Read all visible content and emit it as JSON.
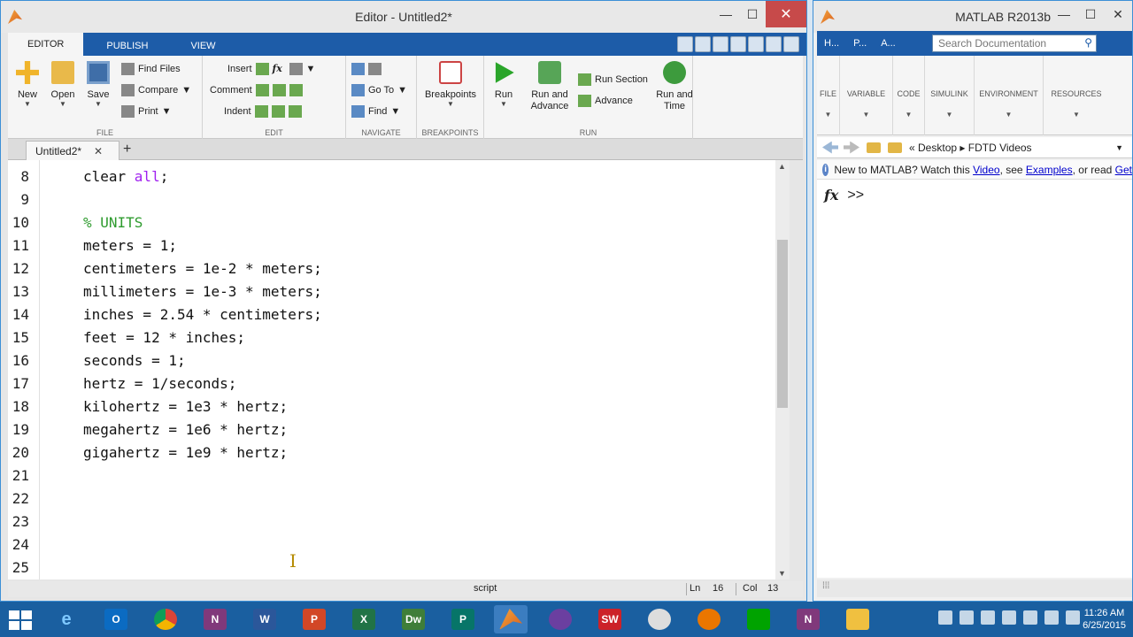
{
  "editor": {
    "title": "Editor - Untitled2*",
    "ribbon_tabs": [
      "EDITOR",
      "PUBLISH",
      "VIEW"
    ],
    "file_group": {
      "label": "FILE",
      "new": "New",
      "open": "Open",
      "save": "Save",
      "find_files": "Find Files",
      "compare": "Compare",
      "print": "Print"
    },
    "edit_group": {
      "label": "EDIT",
      "insert": "Insert",
      "comment": "Comment",
      "indent": "Indent"
    },
    "navigate_group": {
      "label": "NAVIGATE",
      "go_to": "Go To",
      "find": "Find"
    },
    "breakpoints_group": {
      "label": "BREAKPOINTS",
      "breakpoints": "Breakpoints"
    },
    "run_group": {
      "label": "RUN",
      "run": "Run",
      "run_and_advance": "Run and Advance",
      "run_section": "Run Section",
      "advance": "Advance",
      "run_and_time": "Run and Time"
    },
    "doc_tab": "Untitled2*",
    "lines": [
      {
        "n": "8",
        "code": "clear all;"
      },
      {
        "n": "9",
        "code": ""
      },
      {
        "n": "10",
        "code": "% UNITS"
      },
      {
        "n": "11",
        "code": "meters = 1;"
      },
      {
        "n": "12",
        "code": "centimeters = 1e-2 * meters;"
      },
      {
        "n": "13",
        "code": "millimeters = 1e-3 * meters;"
      },
      {
        "n": "14",
        "code": "inches = 2.54 * centimeters;"
      },
      {
        "n": "15",
        "code": "feet = 12 * inches;"
      },
      {
        "n": "16",
        "code": "seconds = 1;"
      },
      {
        "n": "17",
        "code": "hertz = 1/seconds;"
      },
      {
        "n": "18",
        "code": "kilohertz = 1e3 * hertz;"
      },
      {
        "n": "19",
        "code": "megahertz = 1e6 * hertz;"
      },
      {
        "n": "20",
        "code": "gigahertz = 1e9 * hertz;"
      },
      {
        "n": "21",
        "code": ""
      },
      {
        "n": "22",
        "code": ""
      },
      {
        "n": "23",
        "code": ""
      },
      {
        "n": "24",
        "code": ""
      },
      {
        "n": "25",
        "code": ""
      }
    ],
    "status": {
      "mode": "script",
      "ln_label": "Ln",
      "ln": "16",
      "col_label": "Col",
      "col": "13"
    }
  },
  "matlab": {
    "title": "MATLAB R2013b",
    "tabs": [
      "H...",
      "P...",
      "A..."
    ],
    "search_placeholder": "Search Documentation",
    "ribbon_groups": [
      "FILE",
      "VARIABLE",
      "CODE",
      "SIMULINK",
      "ENVIRONMENT",
      "RESOURCES"
    ],
    "path": [
      "Desktop",
      "FDTD Videos"
    ],
    "message": {
      "prefix": "New to MATLAB? Watch this ",
      "video": "Video",
      "mid": ", see ",
      "examples": "Examples",
      "suffix": ", or read ",
      "getting": "Get"
    },
    "prompt_fx": "fx",
    "prompt": ">>"
  },
  "taskbar": {
    "apps": [
      "IE",
      "Outlook",
      "Chrome",
      "OneNote",
      "Word",
      "PowerPoint",
      "Excel",
      "Dreamweaver",
      "Publisher",
      "MATLAB",
      "Antenna",
      "SolidWorks",
      "Inkscape",
      "Blender",
      "Store",
      "OneNote 2",
      "Explorer"
    ],
    "time": "11:26 AM",
    "date": "6/25/2015"
  },
  "colors": {
    "accent": "#1d5ca8",
    "keyword": "#a020f0",
    "comment": "#2e9b2e",
    "close": "#c74a4a"
  }
}
